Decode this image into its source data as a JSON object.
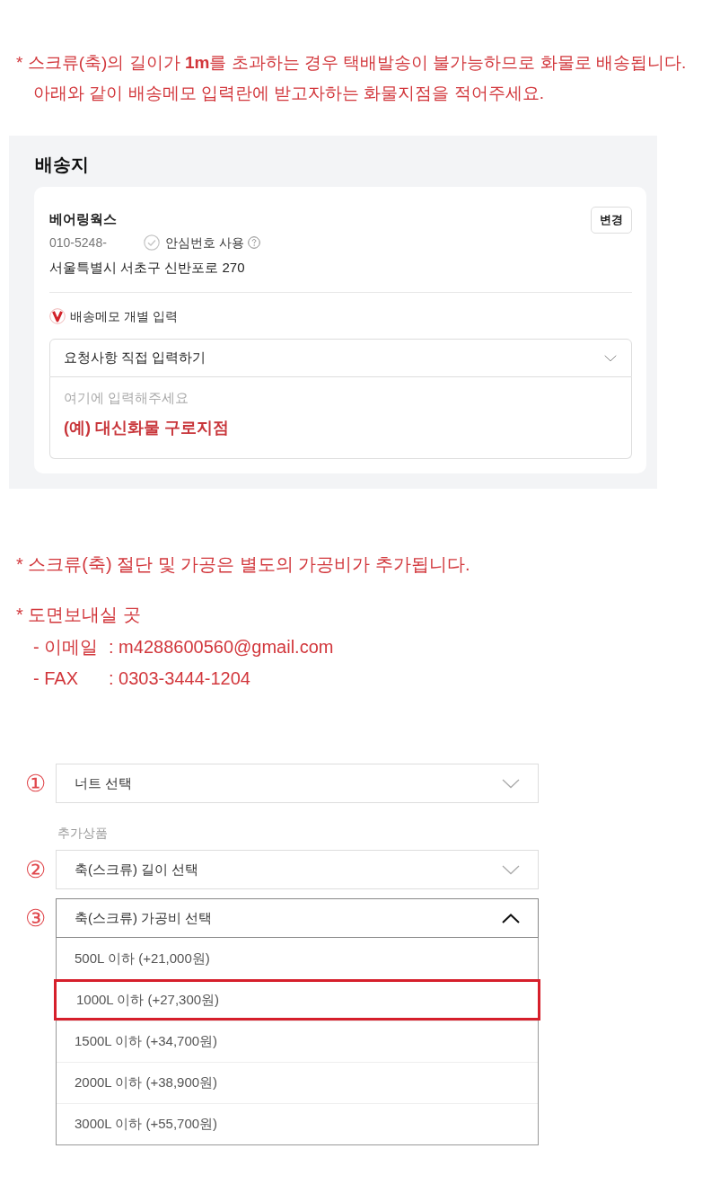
{
  "notice": [
    "* 스크류(축)의 길이가 **1m**를 초과하는 경우 택배발송이 불가능하므로 화물로 배송됩니다.",
    "아래와 같이 배송메모 입력란에 받고자하는 화물지점을 적어주세요."
  ],
  "shipping": {
    "title": "배송지",
    "name": "베어링웍스",
    "phone": "010-5248-",
    "safe_number": {
      "label": "안심번호 사용",
      "checked": false
    },
    "address": "서울특별시 서초구 신반포로 270",
    "change_button": "변경",
    "memo": {
      "label": "배송메모 개별 입력",
      "select": {
        "value": "요청사항 직접 입력하기",
        "expanded": false
      },
      "textarea": {
        "placeholder": "여기에 입력해주세요",
        "example": "(예) 대신화물 구로지점"
      }
    }
  },
  "processing_note": "* 스크류(축) 절단 및 가공은 별도의 가공비가 추가됩니다.",
  "drawing_contact": {
    "title": "* 도면보내실 곳",
    "rows": [
      {
        "label": "- 이메일",
        "value": ": m4288600560@gmail.com"
      },
      {
        "label": "- FAX",
        "value": ": 0303-3444-1204"
      }
    ]
  },
  "options": {
    "main": {
      "marker": "①",
      "value": "너트 선택",
      "expanded": false
    },
    "additional": {
      "label": "추가상품",
      "selects": [
        {
          "marker": "②",
          "value": "축(스크류) 길이 선택",
          "expanded": false
        },
        {
          "marker": "③",
          "value": "축(스크류) 가공비 선택",
          "expanded": true,
          "options": [
            {
              "label": "500L 이하 (+21,000원)",
              "highlighted": false
            },
            {
              "label": "1000L 이하 (+27,300원)",
              "highlighted": true
            },
            {
              "label": "1500L 이하 (+34,700원)",
              "highlighted": false
            },
            {
              "label": "2000L 이하 (+38,900원)",
              "highlighted": false
            },
            {
              "label": "3000L 이하 (+55,700원)",
              "highlighted": false
            }
          ]
        }
      ]
    }
  }
}
